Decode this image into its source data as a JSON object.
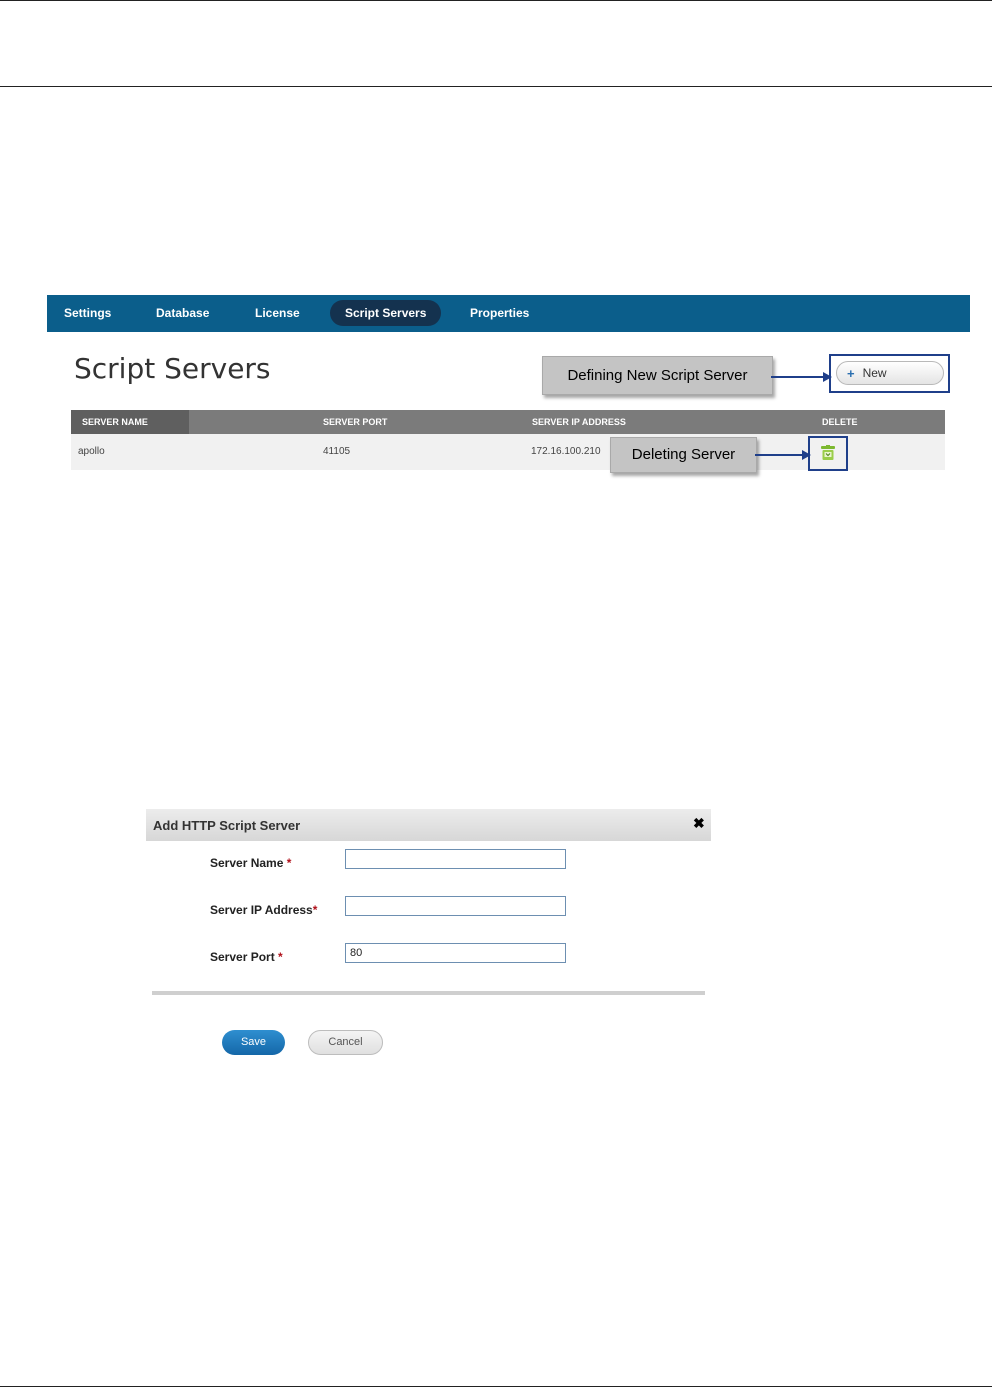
{
  "nav": {
    "items": [
      {
        "label": "Settings"
      },
      {
        "label": "Database"
      },
      {
        "label": "License"
      },
      {
        "label": "Script Servers",
        "active": true
      },
      {
        "label": "Properties"
      }
    ]
  },
  "page": {
    "title": "Script Servers",
    "new_button_label": "New"
  },
  "callouts": {
    "new": "Defining New Script Server",
    "delete": "Deleting Server"
  },
  "table": {
    "headers": [
      "SERVER NAME",
      "SERVER PORT",
      "SERVER IP ADDRESS",
      "DELETE"
    ],
    "rows": [
      {
        "name": "apollo",
        "port": "41105",
        "ip": "172.16.100.210"
      }
    ]
  },
  "dialog": {
    "title": "Add HTTP Script Server",
    "fields": {
      "server_name": {
        "label": "Server Name ",
        "value": ""
      },
      "server_ip": {
        "label": "Server IP Address",
        "value": ""
      },
      "server_port": {
        "label": "Server Port ",
        "value": "80"
      }
    },
    "required_mark": "*",
    "save_label": "Save",
    "cancel_label": "Cancel"
  },
  "colors": {
    "nav_bg": "#0b5e8b",
    "nav_active": "#14324f",
    "callout_border": "#1f3f8a",
    "save_button": "#1a78bd",
    "required": "#b0101a"
  },
  "icons": {
    "new": "plus-icon",
    "delete": "trash-icon",
    "close": "close-icon"
  }
}
